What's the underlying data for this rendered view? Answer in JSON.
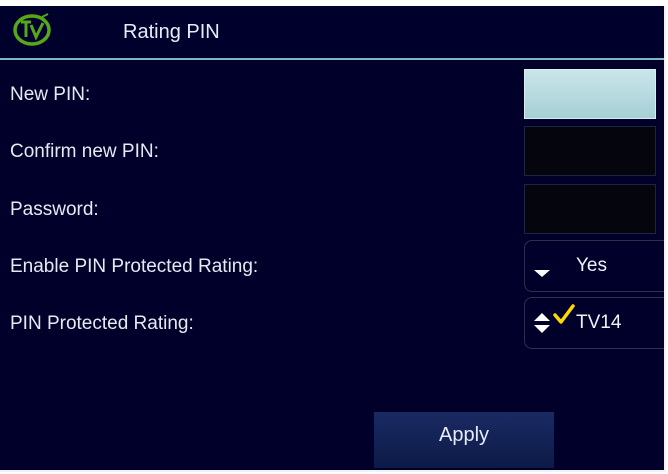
{
  "header": {
    "title": "Rating PIN",
    "logo_icon": "tv-logo-icon"
  },
  "form": {
    "new_pin_label": "New PIN:",
    "confirm_pin_label": "Confirm new PIN:",
    "password_label": "Password:",
    "enable_pin_label": "Enable PIN Protected Rating:",
    "enable_pin_value": "Yes",
    "rating_label": "PIN Protected Rating:",
    "rating_value": "TV14"
  },
  "actions": {
    "apply_label": "Apply"
  },
  "colors": {
    "background": "#00002a",
    "header_rule": "#7fb8c0",
    "focused_input": "#b8dde2",
    "logo_green": "#55a818",
    "check_yellow": "#ffd800"
  }
}
